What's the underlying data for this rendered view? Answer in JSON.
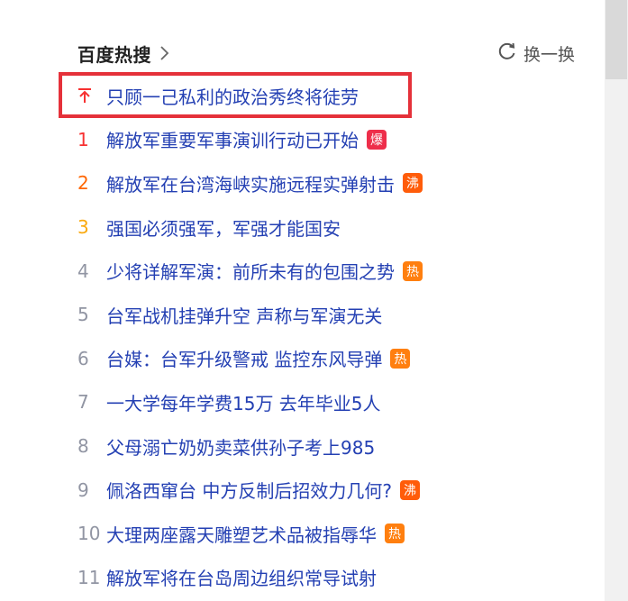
{
  "header": {
    "title": "百度热搜",
    "refresh_label": "换一换"
  },
  "colors": {
    "title": "#222222",
    "link": "#2440b3",
    "rank_1": "#f73131",
    "rank_2": "#ff6600",
    "rank_3": "#faa90e",
    "rank_other": "#9195a3",
    "badge_bao": "#ee2e4a",
    "badge_fei": "#ff5c0a",
    "badge_re": "#ff7f0f",
    "highlight": "#e5313a"
  },
  "items": [
    {
      "rank": "",
      "rank_icon": "pin-top-icon",
      "text": "只顾一己私利的政治秀终将徒劳",
      "badge": ""
    },
    {
      "rank": "1",
      "text": "解放军重要军事演训行动已开始",
      "badge": "爆"
    },
    {
      "rank": "2",
      "text": "解放军在台湾海峡实施远程实弹射击",
      "badge": "沸"
    },
    {
      "rank": "3",
      "text": "强国必须强军，军强才能国安",
      "badge": ""
    },
    {
      "rank": "4",
      "text": "少将详解军演：前所未有的包围之势",
      "badge": "热"
    },
    {
      "rank": "5",
      "text": "台军战机挂弹升空 声称与军演无关",
      "badge": ""
    },
    {
      "rank": "6",
      "text": "台媒：台军升级警戒 监控东风导弹",
      "badge": "热"
    },
    {
      "rank": "7",
      "text": "一大学每年学费15万 去年毕业5人",
      "badge": ""
    },
    {
      "rank": "8",
      "text": "父母溺亡奶奶卖菜供孙子考上985",
      "badge": ""
    },
    {
      "rank": "9",
      "text": "佩洛西窜台 中方反制后招效力几何?",
      "badge": "沸"
    },
    {
      "rank": "10",
      "text": "大理两座露天雕塑艺术品被指辱华",
      "badge": "热"
    },
    {
      "rank": "11",
      "text": "解放军将在台岛周边组织常导试射",
      "badge": ""
    }
  ]
}
